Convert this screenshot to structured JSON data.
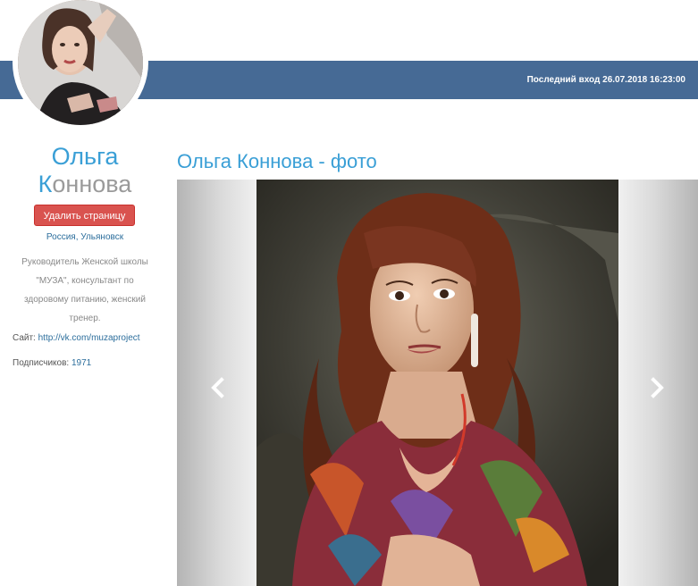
{
  "header": {
    "last_login": "Последний вход 26.07.2018 16:23:00",
    "bar_color": "#466a95"
  },
  "profile": {
    "first_name": "Ольга",
    "last_name_initial": "К",
    "last_name_rest": "оннова",
    "delete_button": "Удалить страницу",
    "location": "Россия, Ульяновск",
    "bio": "Руководитель Женской школы \"МУЗА\", консультант по здоровому питанию, женский тренер.",
    "site_label": "Сайт: ",
    "site_url": "http://vk.com/muzaproject",
    "subscribers_label": "Подписчиков: ",
    "subscribers_count": "1971"
  },
  "gallery": {
    "title": "Ольга Коннова - фото",
    "prev_icon": "chevron-left-icon",
    "next_icon": "chevron-right-icon"
  },
  "colors": {
    "accent": "#3a9fd6",
    "danger": "#d9534f",
    "link": "#2c6e9c"
  }
}
